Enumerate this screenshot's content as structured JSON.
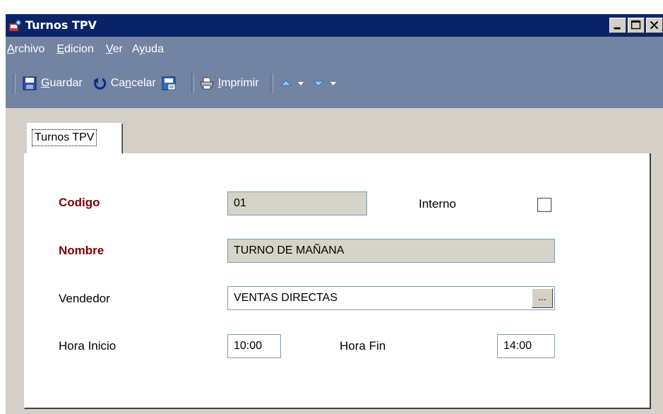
{
  "window": {
    "title": "Turnos TPV",
    "title_color": "#0a246a"
  },
  "menu": [
    {
      "label": "Archivo",
      "mnemonic": "A",
      "rest": "rchivo"
    },
    {
      "label": "Edicion",
      "mnemonic": "E",
      "rest": "dicion"
    },
    {
      "label": "Ver",
      "mnemonic": "V",
      "rest": "er"
    },
    {
      "label": "Ayuda",
      "pre": "A",
      "mnemonic": "y",
      "rest": "uda"
    }
  ],
  "toolbar": {
    "save": {
      "pre": "",
      "mnemonic": "G",
      "rest": "uardar",
      "icon": "floppy-disk-icon"
    },
    "cancel": {
      "pre": "Ca",
      "mnemonic": "n",
      "rest": "celar",
      "icon": "undo-icon"
    },
    "print": {
      "pre": "",
      "mnemonic": "I",
      "rest": "mprimir",
      "icon": "printer-icon"
    }
  },
  "tabs": [
    {
      "label": "Turnos TPV",
      "active": true
    }
  ],
  "form": {
    "codigo": {
      "label": "Codigo",
      "value": "01"
    },
    "interno": {
      "label": "Interno",
      "checked": false
    },
    "nombre": {
      "label": "Nombre",
      "value": "TURNO DE MAÑANA"
    },
    "vendedor": {
      "label": "Vendedor",
      "value": "VENTAS DIRECTAS",
      "lookup_label": "..."
    },
    "hora_inicio": {
      "label": "Hora Inicio",
      "value": "10:00"
    },
    "hora_fin": {
      "label": "Hora Fin",
      "value": "14:00"
    }
  },
  "colors": {
    "menubar": "#7284a2",
    "required_label": "#800000",
    "readonly_field": "#d4d4c8"
  }
}
